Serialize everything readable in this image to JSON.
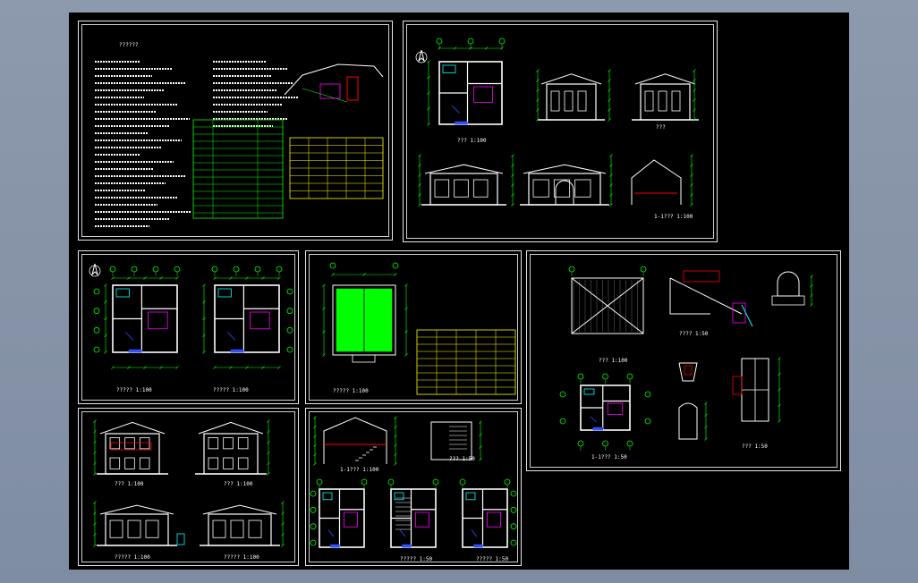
{
  "app": {
    "background": "#8a97ab",
    "canvas_color": "#000000"
  },
  "colors": {
    "frame": "#e8e8e8",
    "wall": "#ffffff",
    "dim": "#00ff00",
    "axis": "#00ff00",
    "text_yellow": "#ffff00",
    "accent_red": "#ff0000",
    "accent_blue": "#3050ff",
    "accent_magenta": "#ff00ff",
    "accent_cyan": "#00ffff"
  },
  "sheets": {
    "notes": {
      "title": "??????"
    },
    "elevations": {
      "caption_a": "??? 1:100",
      "caption_b": "???",
      "caption_c": "1-1??? 1:100"
    },
    "floor_plans": {
      "caption_a": "????? 1:100",
      "caption_b": "????? 1:100"
    },
    "roof_plan": {
      "caption": "????? 1:100"
    },
    "sections": {
      "caption_a": "??? 1:100",
      "caption_b": "??? 1:100",
      "caption_c": "????? 1:100",
      "caption_d": "????? 1:100"
    },
    "details": {
      "caption_a": "??? 1:100",
      "caption_b": "???? 1:50",
      "caption_c": "1-1??? 1:50",
      "caption_d": "??? 1:50"
    },
    "stair_plans": {
      "caption_a": "1-1??? 1:100",
      "caption_b": "??? 1:50",
      "caption_c": "????? 1:50",
      "caption_d": "????? 1:50"
    }
  }
}
